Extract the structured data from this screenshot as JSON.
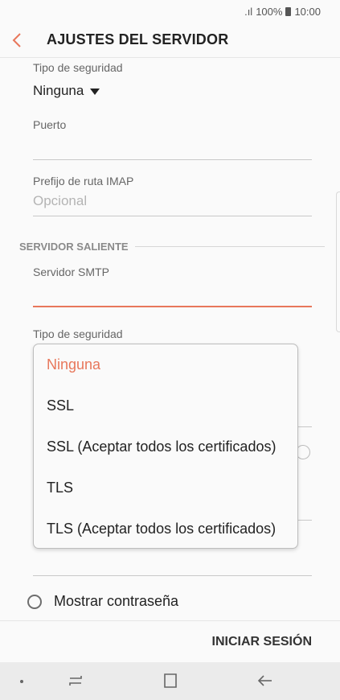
{
  "status": {
    "signal": ".ıl",
    "battery_percent": "100%",
    "time": "10:00"
  },
  "header": {
    "title": "AJUSTES DEL SERVIDOR"
  },
  "incoming": {
    "security_label": "Tipo de seguridad",
    "security_value": "Ninguna",
    "port_label": "Puerto",
    "port_value": "",
    "imap_prefix_label": "Prefijo de ruta IMAP",
    "imap_prefix_placeholder": "Opcional"
  },
  "outgoing": {
    "section_title": "SERVIDOR SALIENTE",
    "smtp_label": "Servidor SMTP",
    "smtp_value": "",
    "security_label": "Tipo de seguridad"
  },
  "security_menu": {
    "selected": "Ninguna",
    "items": [
      "Ninguna",
      "SSL",
      "SSL (Aceptar todos los certificados)",
      "TLS",
      "TLS (Aceptar todos los certificados)"
    ]
  },
  "show_password": {
    "label": "Mostrar contraseña",
    "checked": false
  },
  "footer": {
    "login_label": "INICIAR SESIÓN"
  },
  "colors": {
    "accent": "#e8775b",
    "text": "#222222",
    "label": "#666666",
    "placeholder": "#b4b4b4"
  }
}
